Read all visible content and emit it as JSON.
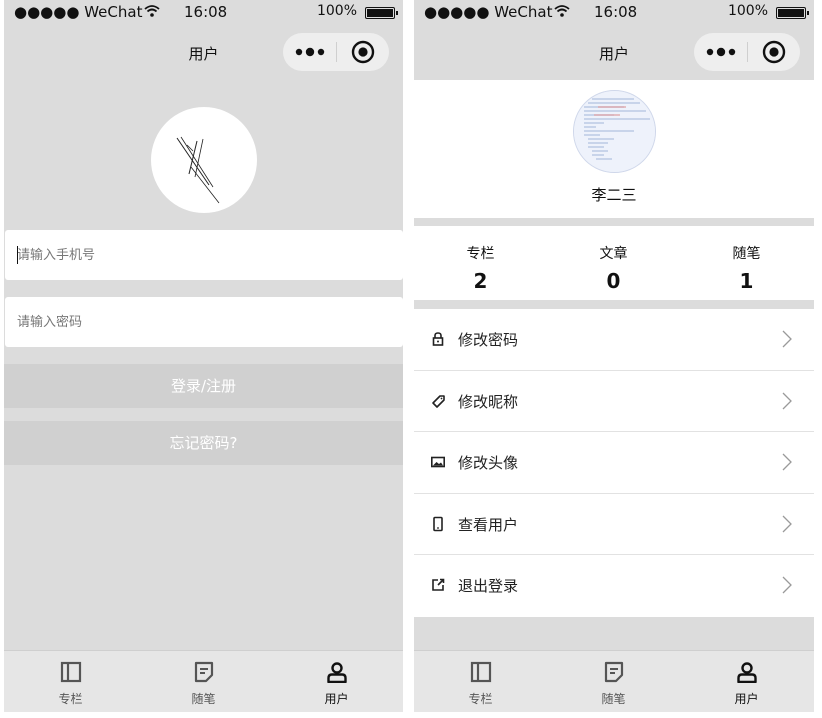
{
  "status_bar": {
    "carrier": "●●●●● WeChat",
    "time": "16:08",
    "battery": "100%"
  },
  "left": {
    "nav_title": "用户",
    "phone": {
      "placeholder": "请输入手机号",
      "value": ""
    },
    "password": {
      "placeholder": "请输入密码",
      "value": ""
    },
    "login_label": "登录/注册",
    "forgot_label": "忘记密码?"
  },
  "right": {
    "nav_title": "用户",
    "user_name": "李二三",
    "stats": [
      {
        "label": "专栏",
        "value": "2"
      },
      {
        "label": "文章",
        "value": "0"
      },
      {
        "label": "随笔",
        "value": "1"
      }
    ],
    "menu": [
      {
        "label": "修改密码",
        "icon": "lock-icon"
      },
      {
        "label": "修改昵称",
        "icon": "tag-icon"
      },
      {
        "label": "修改头像",
        "icon": "image-icon"
      },
      {
        "label": "查看用户",
        "icon": "phone-icon"
      },
      {
        "label": "退出登录",
        "icon": "exit-icon"
      }
    ]
  },
  "tabbar": [
    {
      "label": "专栏",
      "icon": "column-icon",
      "active": false
    },
    {
      "label": "随笔",
      "icon": "note-icon",
      "active": false
    },
    {
      "label": "用户",
      "icon": "user-icon",
      "active": true
    }
  ]
}
